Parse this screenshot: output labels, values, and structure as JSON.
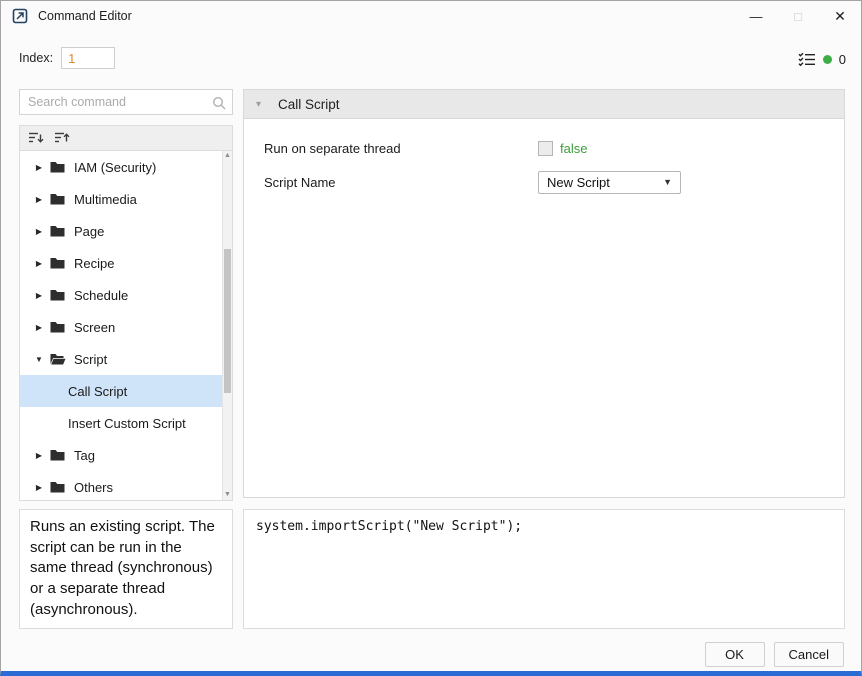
{
  "colors": {
    "accent-blue": "#2a6bd6",
    "value-orange": "#e0872f",
    "bool-green": "#3e9e3a",
    "selection-blue": "#cfe4f8"
  },
  "window": {
    "title": "Command Editor",
    "minimize": "—",
    "maximize": "□",
    "close": "✕"
  },
  "header": {
    "index_label": "Index:",
    "index_value": "1",
    "issue_count": "0"
  },
  "sidebar": {
    "search_placeholder": "Search command",
    "tree": [
      {
        "label": "IAM (Security)"
      },
      {
        "label": "Multimedia"
      },
      {
        "label": "Page"
      },
      {
        "label": "Recipe"
      },
      {
        "label": "Schedule"
      },
      {
        "label": "Screen"
      },
      {
        "label": "Script"
      },
      {
        "label": "Call Script"
      },
      {
        "label": "Insert Custom Script"
      },
      {
        "label": "Tag"
      },
      {
        "label": "Others"
      }
    ],
    "description": "Runs an existing script. The script can be run in the same thread (synchronous) or a separate thread (asynchronous)."
  },
  "main": {
    "panel_title": "Call Script",
    "fields": [
      {
        "label": "Run on separate thread",
        "value": "false"
      },
      {
        "label": "Script Name",
        "value": "New Script"
      }
    ],
    "code": "system.importScript(\"New Script\");"
  },
  "footer": {
    "ok": "OK",
    "cancel": "Cancel"
  }
}
